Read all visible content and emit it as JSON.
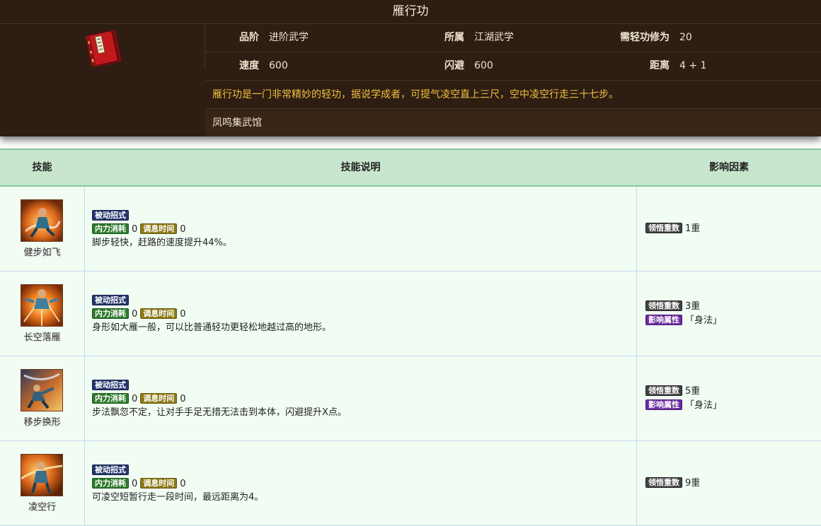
{
  "header": {
    "title": "雁行功",
    "book_icon": "book-icon",
    "stats": {
      "grade_label": "品阶",
      "grade_value": "进阶武学",
      "belong_label": "所属",
      "belong_value": "江湖武学",
      "req_label": "需轻功修为",
      "req_value": "20",
      "speed_label": "速度",
      "speed_value": "600",
      "dodge_label": "闪避",
      "dodge_value": "600",
      "distance_label": "距离",
      "distance_value": "4 + 1"
    },
    "description": "雁行功是一门非常精妙的轻功，据说学成者，可提气凌空直上三尺，空中凌空行走三十七步。",
    "source": "凤鸣集武馆"
  },
  "table": {
    "col_skill": "技能",
    "col_desc": "技能说明",
    "col_factors": "影响因素",
    "tags": {
      "passive": "被动招式",
      "mp_cost": "内力消耗",
      "cooldown": "调息时间",
      "comprehension": "领悟重数",
      "attribute": "影响属性"
    },
    "rows": [
      {
        "name": "健步如飞",
        "mp": "0",
        "cd": "0",
        "desc": "脚步轻快，赶路的速度提升44%。",
        "level": "1重",
        "attribute": ""
      },
      {
        "name": "长空落雁",
        "mp": "0",
        "cd": "0",
        "desc": "身形如大雁一般，可以比普通轻功更轻松地越过高的地形。",
        "level": "3重",
        "attribute": "「身法」"
      },
      {
        "name": "移步换形",
        "mp": "0",
        "cd": "0",
        "desc": "步法飘忽不定，让对手手足无措无法击到本体，闪避提升X点。",
        "level": "5重",
        "attribute": "「身法」"
      },
      {
        "name": "凌空行",
        "mp": "0",
        "cd": "0",
        "desc": "可凌空短暂行走一段时间，最远距离为4。",
        "level": "9重",
        "attribute": ""
      }
    ]
  },
  "colors": {
    "card_bg": "#2d1d12",
    "desc_text": "#f0c040",
    "table_header_bg": "#c8e6cd",
    "row_bg": "#f1fdf3"
  }
}
